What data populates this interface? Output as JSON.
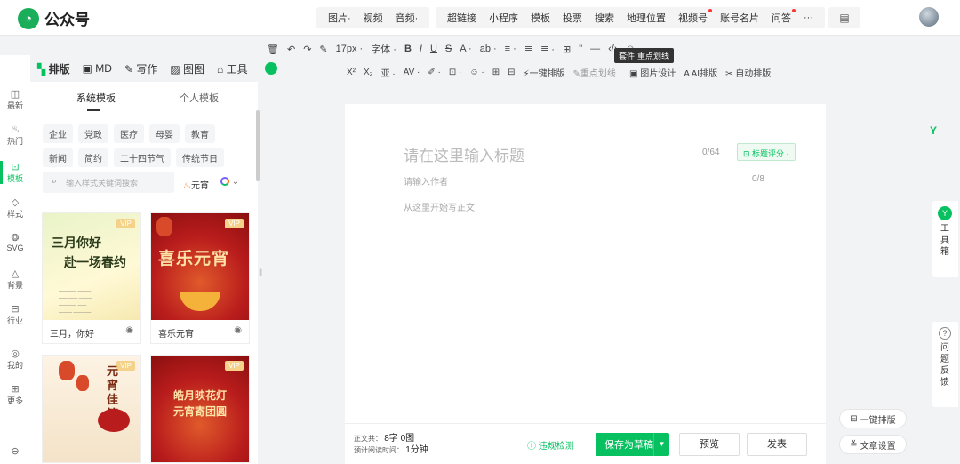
{
  "app": {
    "name": "公众号"
  },
  "topbar": {
    "group1": [
      "图片·",
      "视频",
      "音频·"
    ],
    "group2": [
      "超链接",
      "小程序",
      "模板",
      "投票",
      "搜索",
      "地理位置",
      "视频号",
      "账号名片",
      "问答",
      "···"
    ],
    "red_dot_items": [
      "视频号",
      "问答"
    ]
  },
  "toolbar1": {
    "font_size": "17px ·",
    "font_family": "字体 ·",
    "items": [
      "🗑",
      "↶",
      "↷",
      "✎",
      "B",
      "I",
      "U",
      "S",
      "A ·",
      "ab ·",
      "≡ ·",
      "≣",
      "≣ ·",
      "⊞",
      "\"",
      "—",
      "‹/›",
      "☺"
    ]
  },
  "toolbar2": {
    "items": [
      "X²",
      "X₂",
      "亚 ·",
      "AV ·",
      "✐ ·",
      "⊡ ·",
      "☺ ·",
      "⊞",
      "⊟"
    ],
    "onekey": "一键排版",
    "highlight": "重点划线 ·",
    "design": "图片设计",
    "ai": "AI排版",
    "auto": "自动排版"
  },
  "tooltip": "套件·重点划线",
  "left_tabs": {
    "paiban": "排版",
    "md": "MD",
    "xiezuo": "写作",
    "tutu": "图图",
    "gongju": "工具"
  },
  "rail": [
    {
      "label": "最新",
      "icon": "◫"
    },
    {
      "label": "热门",
      "icon": "♨"
    },
    {
      "label": "模板",
      "icon": "⊡"
    },
    {
      "label": "样式",
      "icon": "◇"
    },
    {
      "label": "SVG",
      "icon": "❂"
    },
    {
      "label": "背景",
      "icon": "△"
    },
    {
      "label": "行业",
      "icon": "⊟"
    },
    {
      "label": "我的",
      "icon": "◎"
    },
    {
      "label": "更多",
      "icon": "⊞"
    },
    {
      "label": "",
      "icon": "⊖"
    }
  ],
  "panel": {
    "tab_system": "系统模板",
    "tab_personal": "个人模板",
    "chips": [
      "企业",
      "党政",
      "医疗",
      "母婴",
      "教育",
      "新闻",
      "简约",
      "二十四节气",
      "传统节日"
    ],
    "search_placeholder": "输入样式关键词搜索",
    "hot": "元宵",
    "cards": [
      {
        "caption": "三月，你好",
        "title1": "三月你好",
        "title2": "赴一场春约",
        "vip": "VIP"
      },
      {
        "caption": "喜乐元宵",
        "title": "喜乐元宵",
        "vip": "VIP"
      },
      {
        "caption": "",
        "title": "元宵佳節",
        "vip": "VIP"
      },
      {
        "caption": "",
        "title1": "皓月映花灯",
        "title2": "元宵寄团圆",
        "vip": "VIP"
      }
    ]
  },
  "editor": {
    "title_placeholder": "请在这里输入标题",
    "title_count": "0/64",
    "score_btn": "标题评分 ·",
    "author_placeholder": "请输入作者",
    "author_count": "0/8",
    "body_placeholder": "从这里开始写正文"
  },
  "footer": {
    "wc_label": "正文共：",
    "wc_value": "8字 0图",
    "read_label": "预计阅读时间：",
    "read_value": "1分钟",
    "check": "违规检测",
    "save": "保存为草稿",
    "preview": "预览",
    "publish": "发表"
  },
  "right": {
    "toolbox": "工具箱",
    "feedback": "问题反馈",
    "onekey": "一键排版",
    "settings": "文章设置"
  }
}
